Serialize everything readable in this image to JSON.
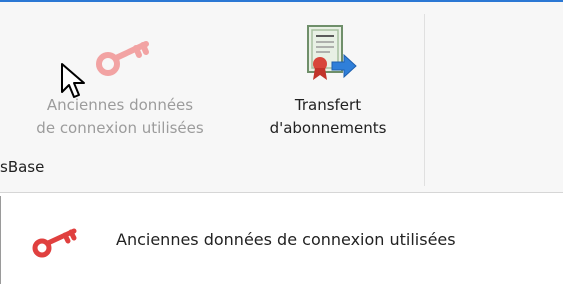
{
  "ribbon": {
    "buttons": [
      {
        "id": "legacy",
        "icon": "key-icon",
        "line1": "Anciennes données",
        "line2": "de connexion utilisées",
        "disabled": true
      },
      {
        "id": "transfer",
        "icon": "certificate-transfer-icon",
        "line1": "Transfert",
        "line2": "d'abonnements",
        "disabled": false
      }
    ],
    "group_label": "sBase"
  },
  "tooltip": {
    "icon": "key-icon",
    "text": "Anciennes données de connexion utilisées"
  },
  "colors": {
    "accent": "#2b78d4",
    "key_red": "#e0403f",
    "key_red_faded": "#f2a3a3",
    "disabled_text": "#9c9c9c"
  }
}
